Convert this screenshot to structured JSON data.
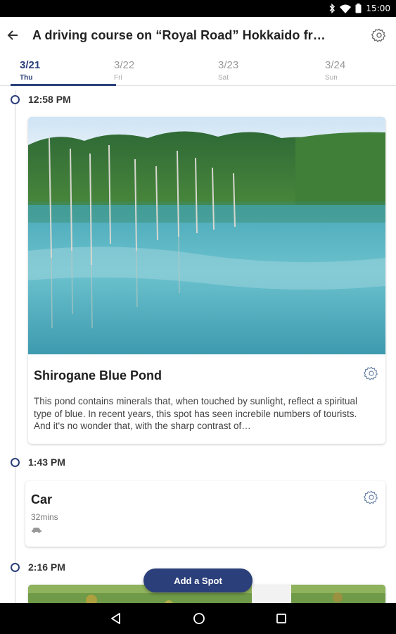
{
  "status": {
    "time": "15:00"
  },
  "header": {
    "title": "A driving course on “Royal Road” Hokkaido from…"
  },
  "tabs": [
    {
      "date": "3/21",
      "day": "Thu"
    },
    {
      "date": "3/22",
      "day": "Fri"
    },
    {
      "date": "3/23",
      "day": "Sat"
    },
    {
      "date": "3/24",
      "day": "Sun"
    }
  ],
  "timeline": [
    {
      "time": "12:58 PM",
      "title": "Shirogane Blue Pond",
      "description": "This pond contains minerals that, when touched by sunlight, reflect a spiritual type of blue. In recent years, this spot has seen increbile numbers of tourists. And it's no wonder that, with the sharp contrast of…"
    },
    {
      "time": "1:43 PM",
      "title": "Car",
      "duration": "32mins"
    },
    {
      "time": "2:16 PM"
    }
  ],
  "fab": {
    "label": "Add a Spot"
  },
  "colors": {
    "accent": "#2b3f7a",
    "status_bar": "#000000"
  }
}
